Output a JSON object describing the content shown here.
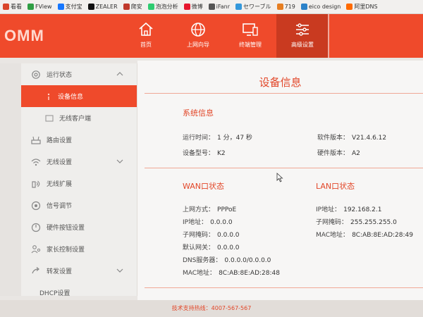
{
  "bookmarks": [
    {
      "label": "看看",
      "color": "#d9452b"
    },
    {
      "label": "FView",
      "color": "#2f9e44"
    },
    {
      "label": "支付宝",
      "color": "#1677ff"
    },
    {
      "label": "ZEALER",
      "color": "#111111"
    },
    {
      "label": "爬安",
      "color": "#c0392b"
    },
    {
      "label": "泡泡分析",
      "color": "#2ecc71"
    },
    {
      "label": "微博",
      "color": "#e6162d"
    },
    {
      "label": "iFanr",
      "color": "#555555"
    },
    {
      "label": "セワーブル",
      "color": "#3498db"
    },
    {
      "label": "719",
      "color": "#e67e22"
    },
    {
      "label": "eico design",
      "color": "#2c82c9"
    },
    {
      "label": "阿里DNS",
      "color": "#ff6a00"
    }
  ],
  "header": {
    "logo": "OMM",
    "nav": [
      {
        "label": "首页",
        "icon": "home-icon"
      },
      {
        "label": "上网向导",
        "icon": "globe-icon"
      },
      {
        "label": "终端管理",
        "icon": "devices-icon"
      },
      {
        "label": "高级设置",
        "icon": "sliders-icon"
      }
    ]
  },
  "sidebar": {
    "items": [
      {
        "label": "运行状态",
        "icon": "gear-icon"
      },
      {
        "label": "设备信息"
      },
      {
        "label": "无线客户端"
      },
      {
        "label": "路由设置",
        "icon": "router-icon"
      },
      {
        "label": "无线设置",
        "icon": "wifi-icon"
      },
      {
        "label": "无线扩展",
        "icon": "extend-icon"
      },
      {
        "label": "信号调节",
        "icon": "signal-icon"
      },
      {
        "label": "硬件按钮设置",
        "icon": "hardware-icon"
      },
      {
        "label": "家长控制设置",
        "icon": "parental-icon"
      },
      {
        "label": "转发设置",
        "icon": "forward-icon"
      },
      {
        "label": "DHCP设置",
        "icon": "dhcp-icon"
      }
    ]
  },
  "main": {
    "title": "设备信息",
    "system": {
      "title": "系统信息",
      "uptime_label": "运行时间：",
      "uptime": "1 分，47 秒",
      "model_label": "设备型号：",
      "model": "K2",
      "sw_label": "软件版本：",
      "sw": "V21.4.6.12",
      "hw_label": "硬件版本：",
      "hw": "A2"
    },
    "wan": {
      "title": "WAN口状态",
      "mode_label": "上网方式：",
      "mode": "PPPoE",
      "ip_label": "IP地址：",
      "ip": "0.0.0.0",
      "mask_label": "子网掩码：",
      "mask": "0.0.0.0",
      "gw_label": "默认网关：",
      "gw": "0.0.0.0",
      "dns_label": "DNS服务器：",
      "dns": "0.0.0.0/0.0.0.0",
      "mac_label": "MAC地址：",
      "mac": "8C:AB:8E:AD:28:48"
    },
    "lan": {
      "title": "LAN口状态",
      "ip_label": "IP地址：",
      "ip": "192.168.2.1",
      "mask_label": "子网掩码：",
      "mask": "255.255.255.0",
      "mac_label": "MAC地址：",
      "mac": "8C:AB:8E:AD:28:49"
    }
  },
  "footer": {
    "text": "技术支持热线：4007-567-567"
  },
  "colors": {
    "accent": "#ef4a2b",
    "accent_dark": "#c93a20"
  }
}
